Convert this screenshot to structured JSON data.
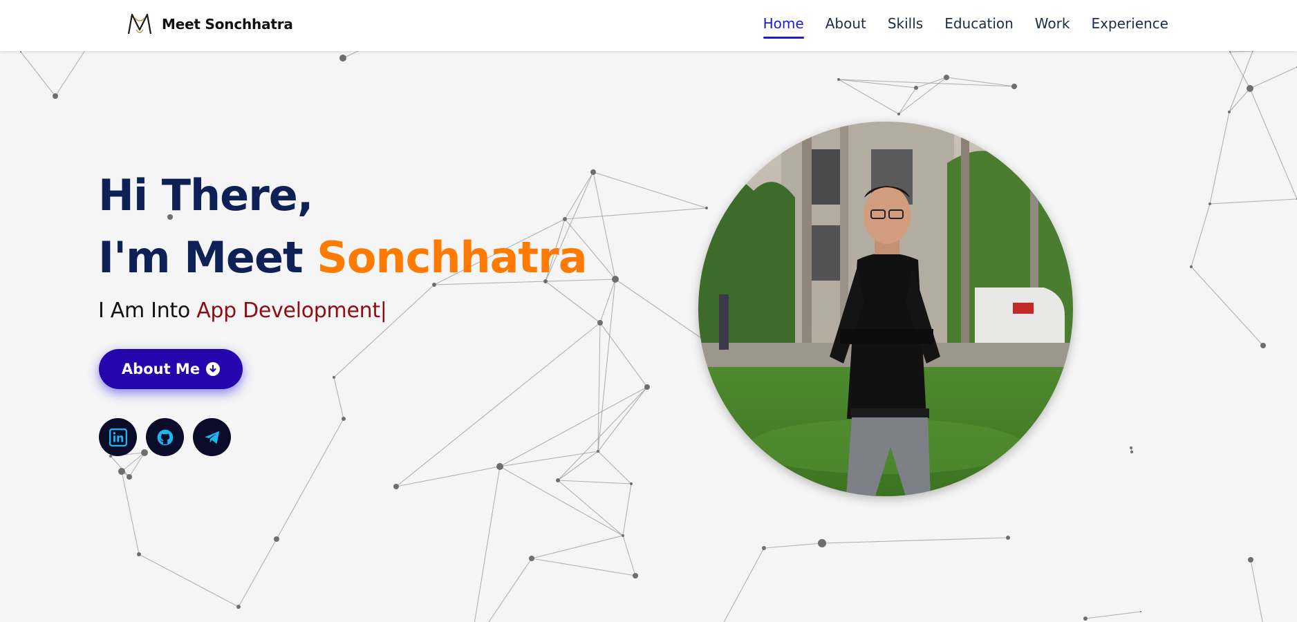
{
  "nav": {
    "brand_name": "Meet Sonchhatra",
    "logo_icon": "ms-monogram-logo-icon",
    "links": [
      {
        "label": "Home",
        "active": true
      },
      {
        "label": "About",
        "active": false
      },
      {
        "label": "Skills",
        "active": false
      },
      {
        "label": "Education",
        "active": false
      },
      {
        "label": "Work",
        "active": false
      },
      {
        "label": "Experience",
        "active": false
      }
    ]
  },
  "hero": {
    "greeting": "Hi There,",
    "intro_prefix": "I'm Meet ",
    "intro_highlight": "Sonchhatra",
    "tagline_prefix": "I Am Into ",
    "tagline_role": "App Development",
    "cursor": "|",
    "cta_label": "About Me",
    "cta_icon": "arrow-circle-down-icon"
  },
  "socials": [
    {
      "name": "LinkedIn",
      "icon": "linkedin-icon"
    },
    {
      "name": "GitHub",
      "icon": "github-icon"
    },
    {
      "name": "Telegram",
      "icon": "telegram-icon"
    }
  ],
  "colors": {
    "navy": "#0d2157",
    "orange": "#ff7a00",
    "role_red": "#8f0d12",
    "button_blue": "#2506ad",
    "nav_active": "#1b1bd6",
    "social_bg": "#0b0b2a",
    "social_icon": "#1fb6f0",
    "background": "#f5f5f5"
  }
}
